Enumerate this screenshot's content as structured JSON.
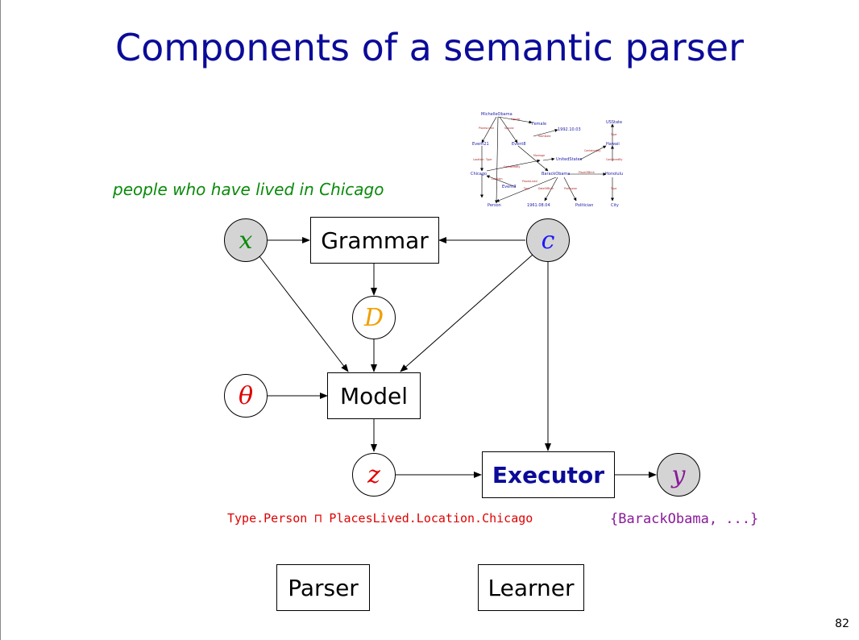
{
  "slide": {
    "title": "Components of a semantic parser",
    "page_number": "82"
  },
  "query": "people who have lived in Chicago",
  "nodes": {
    "x": "x",
    "c": "c",
    "D": "D",
    "theta": "θ",
    "z": "z",
    "y": "y"
  },
  "boxes": {
    "grammar": "Grammar",
    "model": "Model",
    "executor": "Executor",
    "parser": "Parser",
    "learner": "Learner"
  },
  "logical_form": "Type.Person ⊓ PlacesLived.Location.Chicago",
  "denotation": "{BarackObama, ...}",
  "colors": {
    "title": "#0b0b99",
    "query": "#0a8a0a",
    "x": "#0a8a0a",
    "c": "#1a1aff",
    "D": "#f0a000",
    "theta": "#e00000",
    "z": "#e00000",
    "y": "#8a1a9a",
    "executor": "#0b0b99",
    "logical_form": "#e00000",
    "denotation": "#8a1a9a"
  },
  "knowledge_graph": {
    "nodes": [
      "MichelleObama",
      "Female",
      "1992.10.03",
      "USState",
      "Event21",
      "Event8",
      "Hawaii",
      "UnitedStates",
      "Chicago",
      "BarackObama",
      "Honolulu",
      "Event3",
      "Person",
      "1961.08.04",
      "Politician",
      "City"
    ],
    "edge_labels": [
      "Gender",
      "PlacesLived",
      "Spouse",
      "StartDate",
      "Type",
      "ContainedBy",
      "Marriage",
      "Location",
      "Type",
      "ContainedBy",
      "ContainedBy",
      "PlacesLived",
      "PlaceOfBirth",
      "DateOfBirth",
      "Profession",
      "Type",
      "Location",
      "Type"
    ]
  }
}
